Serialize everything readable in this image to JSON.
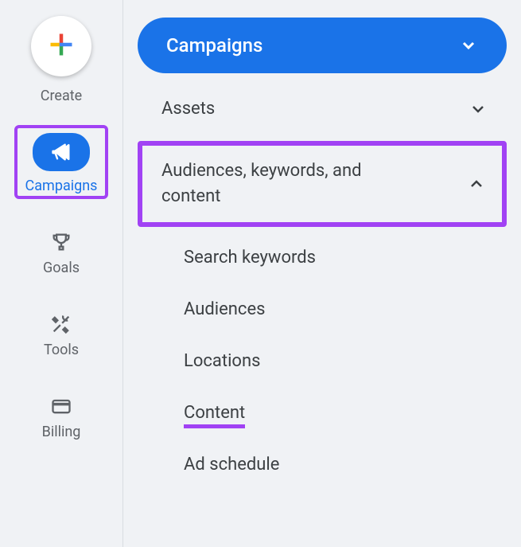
{
  "rail": {
    "create_label": "Create",
    "items": [
      {
        "icon": "megaphone-icon",
        "label": "Campaigns",
        "active": true,
        "highlighted": true
      },
      {
        "icon": "trophy-icon",
        "label": "Goals"
      },
      {
        "icon": "tools-icon",
        "label": "Tools"
      },
      {
        "icon": "card-icon",
        "label": "Billing"
      }
    ]
  },
  "nav": {
    "primary": {
      "label": "Campaigns"
    },
    "rows": [
      {
        "label": "Assets",
        "expanded": false
      },
      {
        "label": "Audiences, keywords, and content",
        "expanded": true,
        "highlighted": true
      }
    ],
    "sub_items": [
      {
        "label": "Search keywords"
      },
      {
        "label": "Audiences"
      },
      {
        "label": "Locations"
      },
      {
        "label": "Content",
        "selected": true
      },
      {
        "label": "Ad schedule"
      }
    ]
  }
}
